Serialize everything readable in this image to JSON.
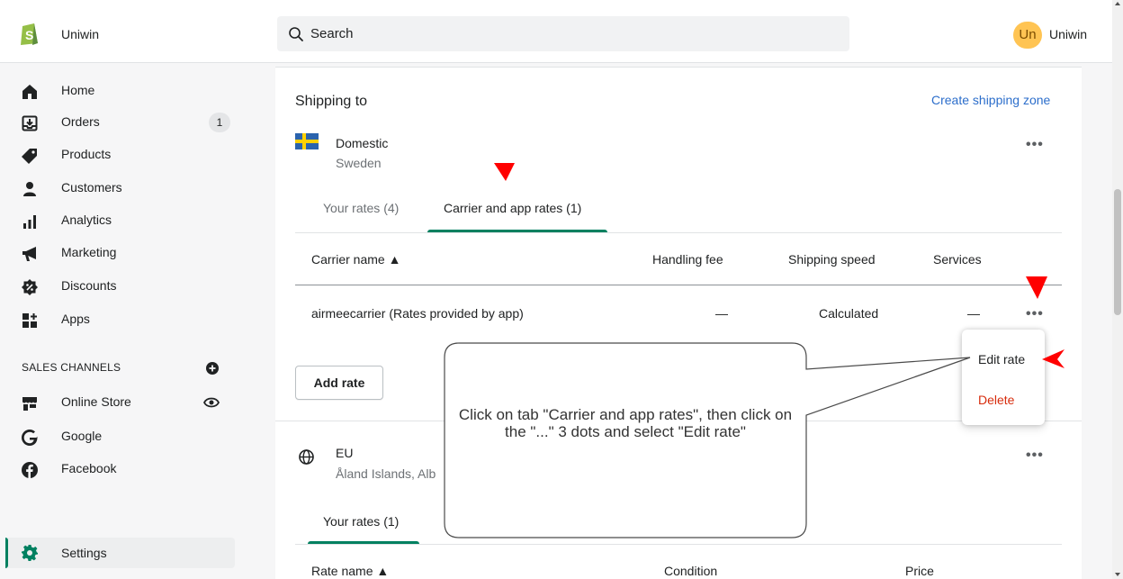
{
  "header": {
    "store_name": "Uniwin",
    "search_placeholder": "Search",
    "avatar_initials": "Un",
    "user_name": "Uniwin"
  },
  "sidebar": {
    "items": [
      {
        "label": "Home",
        "icon": "home-icon"
      },
      {
        "label": "Orders",
        "icon": "orders-icon",
        "badge": "1"
      },
      {
        "label": "Products",
        "icon": "tag-icon"
      },
      {
        "label": "Customers",
        "icon": "person-icon"
      },
      {
        "label": "Analytics",
        "icon": "bar-chart-icon"
      },
      {
        "label": "Marketing",
        "icon": "megaphone-icon"
      },
      {
        "label": "Discounts",
        "icon": "discount-icon"
      },
      {
        "label": "Apps",
        "icon": "apps-icon"
      }
    ],
    "sales_channels_title": "SALES CHANNELS",
    "channels": [
      {
        "label": "Online Store",
        "icon": "store-icon"
      },
      {
        "label": "Google",
        "icon": "google-icon"
      },
      {
        "label": "Facebook",
        "icon": "facebook-icon"
      }
    ],
    "settings_label": "Settings"
  },
  "shipping": {
    "title": "Shipping to",
    "create_zone": "Create shipping zone",
    "domestic": {
      "name": "Domestic",
      "countries": "Sweden",
      "tabs": [
        {
          "label": "Your rates (4)",
          "active": false
        },
        {
          "label": "Carrier and app rates (1)",
          "active": true
        }
      ],
      "columns": [
        "Carrier name ▲",
        "Handling fee",
        "Shipping speed",
        "Services"
      ],
      "rows": [
        {
          "carrier": "airmeecarrier (Rates provided by app)",
          "handling_fee": "—",
          "shipping_speed": "Calculated",
          "services": "—"
        }
      ],
      "add_rate": "Add rate"
    },
    "eu": {
      "name": "EU",
      "countries": "Åland Islands, Alb",
      "tabs": [
        {
          "label": "Your rates (1)",
          "active": true
        }
      ],
      "columns": [
        "Rate name ▲",
        "Condition",
        "Price"
      ]
    }
  },
  "popover": {
    "edit": "Edit rate",
    "delete": "Delete"
  },
  "annotation": {
    "text": "Click on tab \"Carrier and app rates\", then click on the \"...\" 3 dots and select \"Edit rate\""
  },
  "more_label": "•••",
  "colors": {
    "accent": "#008060",
    "link": "#2c6ecb",
    "danger": "#d72c0d",
    "annotation_arrow": "#ff0000",
    "avatar": "#ffc453"
  }
}
